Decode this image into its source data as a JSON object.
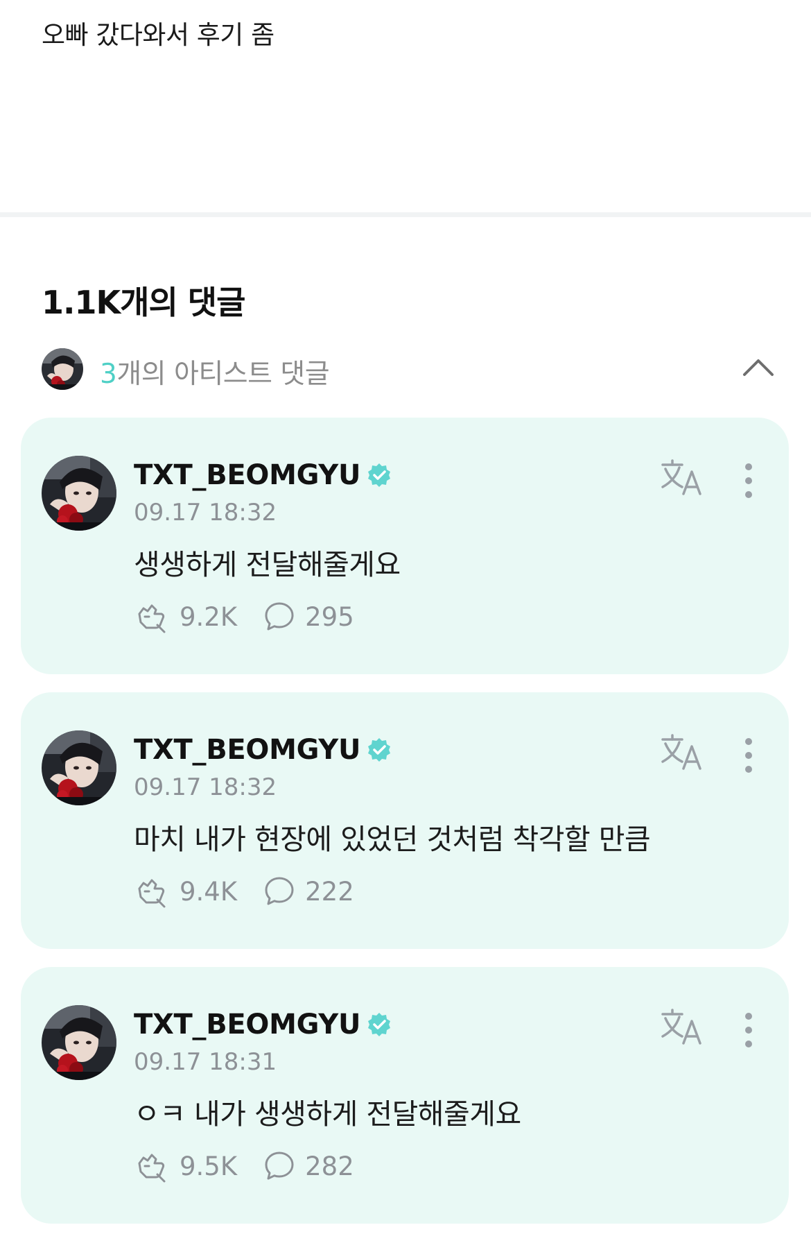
{
  "post": {
    "body": "오빠 갔다와서 후기 좀"
  },
  "comments_header": {
    "count": "1.1K",
    "suffix": "개의 댓글"
  },
  "artist_comments": {
    "count": "3",
    "label": "개의 아티스트 댓글",
    "collapse_icon": "chevron-up-icon"
  },
  "colors": {
    "accent": "#4fd0c6",
    "card_background": "#e9f9f5",
    "muted_text": "#8d9196",
    "verified": "#5fd4cf"
  },
  "icons": {
    "verified": "verified-badge-icon",
    "translate": "translate-icon",
    "more": "more-vertical-icon",
    "reaction": "reaction-icon",
    "comment": "comment-bubble-icon"
  },
  "comments": [
    {
      "author": "TXT_BEOMGYU",
      "time": "09.17 18:32",
      "text": "생생하게 전달해줄게요",
      "likes": "9.2K",
      "replies": "295"
    },
    {
      "author": "TXT_BEOMGYU",
      "time": "09.17 18:32",
      "text": "마치 내가 현장에 있었던 것처럼 착각할 만큼",
      "likes": "9.4K",
      "replies": "222"
    },
    {
      "author": "TXT_BEOMGYU",
      "time": "09.17 18:31",
      "text": "ㅇㅋ 내가 생생하게 전달해줄게요",
      "likes": "9.5K",
      "replies": "282"
    }
  ]
}
